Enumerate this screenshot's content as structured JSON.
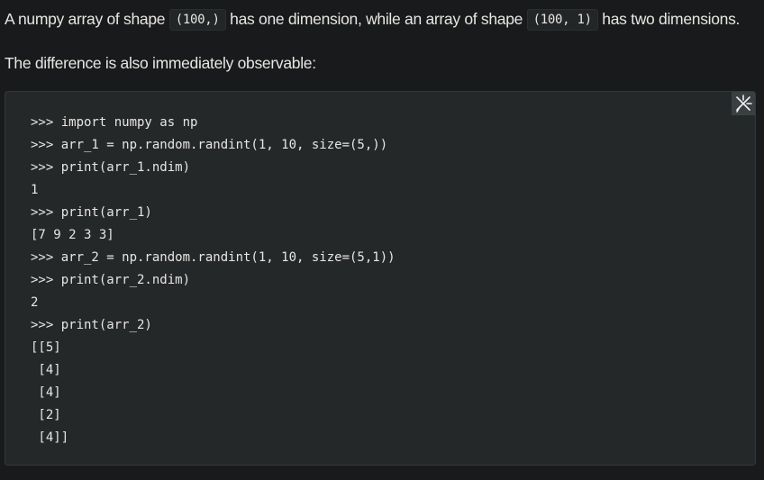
{
  "paragraphs": {
    "p1": {
      "text_a": "A numpy array of shape ",
      "code_a": "(100,)",
      "text_b": " has one dimension, while an array of shape ",
      "code_b": "(100, 1)",
      "text_c": " has two dimensions."
    },
    "p2": {
      "text": "The difference is also immediately observable:"
    }
  },
  "code_block": {
    "copy_icon": "copy-code-icon",
    "lines": [
      ">>> import numpy as np",
      ">>> arr_1 = np.random.randint(1, 10, size=(5,))",
      ">>> print(arr_1.ndim)",
      "1",
      ">>> print(arr_1)",
      "[7 9 2 3 3]",
      ">>> arr_2 = np.random.randint(1, 10, size=(5,1))",
      ">>> print(arr_2.ndim)",
      "2",
      ">>> print(arr_2)",
      "[[5]",
      " [4]",
      " [4]",
      " [2]",
      " [4]]"
    ]
  },
  "colors": {
    "background": "#181a1b",
    "code_block_bg": "#252829",
    "text": "#e8e6e3"
  }
}
